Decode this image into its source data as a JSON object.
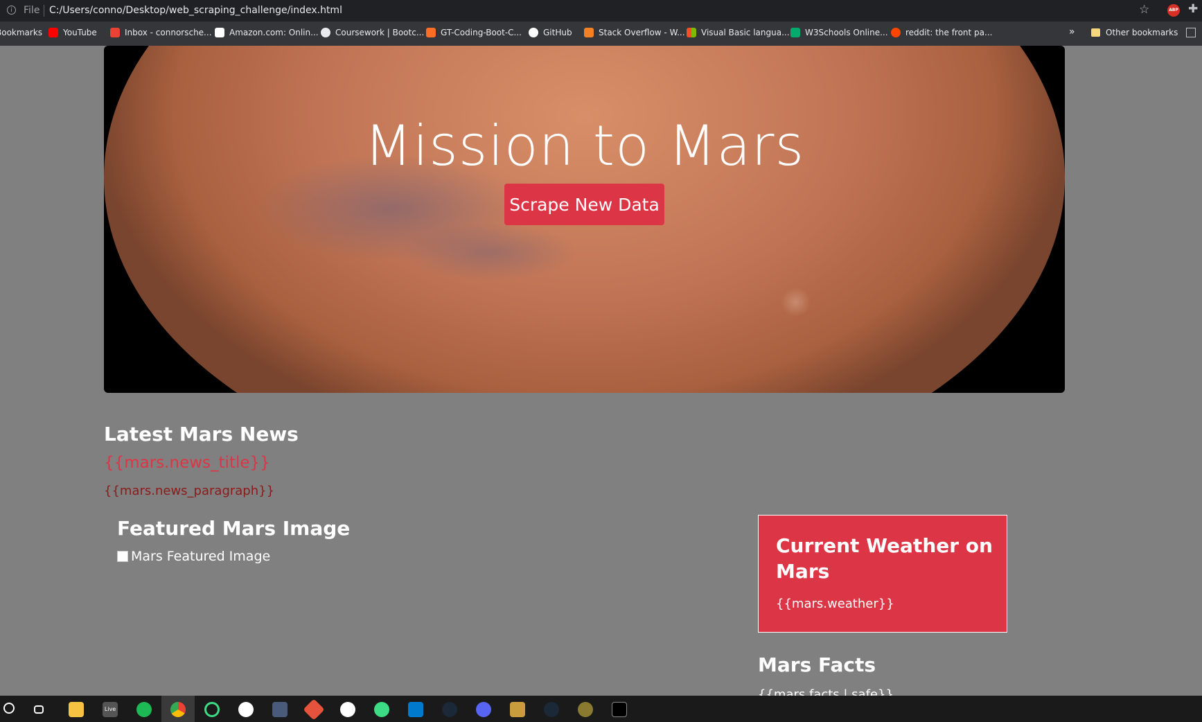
{
  "browser": {
    "file_label": "File",
    "url": "C:/Users/conno/Desktop/web_scraping_challenge/index.html",
    "abp_label": "ABP"
  },
  "bookmarks": {
    "items": [
      {
        "label": "Bookmarks",
        "icon": "folder-icon"
      },
      {
        "label": "YouTube",
        "icon": "youtube-icon",
        "color": "#ff0000"
      },
      {
        "label": "Inbox - connorsche...",
        "icon": "gmail-icon",
        "color": "#ea4335"
      },
      {
        "label": "Amazon.com: Onlin...",
        "icon": "amazon-icon",
        "color": "#ffffff"
      },
      {
        "label": "Coursework | Bootc...",
        "icon": "globe-icon",
        "color": "#e8eaed"
      },
      {
        "label": "GT-Coding-Boot-C...",
        "icon": "gitlab-icon",
        "color": "#fc6d26"
      },
      {
        "label": "GitHub",
        "icon": "github-icon",
        "color": "#ffffff"
      },
      {
        "label": "Stack Overflow - W...",
        "icon": "stackoverflow-icon",
        "color": "#f48024"
      },
      {
        "label": "Visual Basic langua...",
        "icon": "microsoft-icon",
        "color": "#00a4ef"
      },
      {
        "label": "W3Schools Online...",
        "icon": "w3schools-icon",
        "color": "#04aa6d"
      },
      {
        "label": "reddit: the front pa...",
        "icon": "reddit-icon",
        "color": "#ff4500"
      }
    ],
    "overflow": "»",
    "other": "Other bookmarks"
  },
  "hero": {
    "title": "Mission to Mars",
    "button": "Scrape New Data"
  },
  "news": {
    "heading": "Latest Mars News",
    "title": "{{mars.news_title}}",
    "paragraph": "{{mars.news_paragraph}}"
  },
  "featured": {
    "heading": "Featured Mars Image",
    "alt_text": "Mars Featured Image"
  },
  "weather": {
    "heading": "Current Weather on Mars",
    "value": "{{mars.weather}}"
  },
  "facts": {
    "heading": "Mars Facts",
    "value": "{{mars.facts | safe}}"
  },
  "taskbar": {
    "live_label": "Live",
    "apps": [
      "start-icon",
      "task-view-icon",
      "file-explorer-icon",
      "live-icon",
      "spotify-icon",
      "chrome-icon",
      "sync-icon",
      "slack-icon",
      "vscode-alt-icon",
      "git-icon",
      "mongodb-icon",
      "atom-icon",
      "vscode-icon",
      "steam-icon",
      "discord-icon",
      "league-icon",
      "steam-alt-icon",
      "game-icon",
      "terminal-icon"
    ]
  },
  "colors": {
    "page_background": "#808080",
    "accent": "#dc3545"
  }
}
